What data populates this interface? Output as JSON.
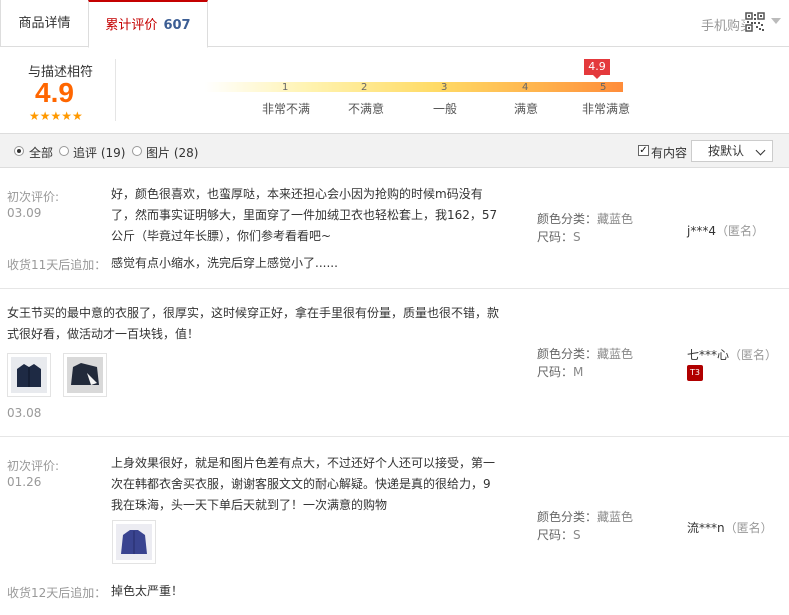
{
  "tabs": {
    "details": "商品详情",
    "reviews": "累计评价",
    "reviews_count": "607",
    "mobile_buy": "手机购买"
  },
  "score": {
    "title": "与描述相符",
    "value": "4.9",
    "stars": "★★★★★",
    "bubble": "4.9",
    "ticks": [
      "1",
      "2",
      "3",
      "4",
      "5"
    ],
    "labels": [
      "非常不满",
      "不满意",
      "一般",
      "满意",
      "非常满意"
    ]
  },
  "filters": {
    "all": "全部",
    "followup": "追评 (19)",
    "photos": "图片 (28)",
    "has_content": "有内容",
    "sort": "按默认"
  },
  "reviews": [
    {
      "initial_label": "初次评价:",
      "date": "03.09",
      "lines": [
        "好，颜色很喜欢，也蛮厚哒，本来还担心会小因为抢购的时候m码没有",
        "了，然而事实证明够大，里面穿了一件加绒卫衣也轻松套上，我162，57",
        "公斤（毕竟过年长膘），你们参考看看吧~"
      ],
      "followup_label": "收货11天后追加：",
      "followup": "感觉有点小缩水，洗完后穿上感觉小了......",
      "color_label": "颜色分类：",
      "color_value": "藏蓝色",
      "size_label": "尺码：",
      "size_value": "S",
      "user": "j***4",
      "anon": "（匿名）"
    },
    {
      "lines": [
        "女王节买的最中意的衣服了，很厚实，这时候穿正好，拿在手里很有份量，质量也很不错，款",
        "式很好看，做活动才一百块钱，值！"
      ],
      "date": "03.08",
      "color_label": "颜色分类：",
      "color_value": "藏蓝色",
      "size_label": "尺码：",
      "size_value": "M",
      "user": "七***心",
      "anon": "（匿名）",
      "badge": "T3"
    },
    {
      "initial_label": "初次评价:",
      "date": "01.26",
      "lines": [
        "上身效果很好，就是和图片色差有点大，不过还好个人还可以接受，第一",
        "次在韩都衣舍买衣服，谢谢客服文文的耐心解疑。快递是真的很给力，9",
        "我在珠海，头一天下单后天就到了！一次满意的购物"
      ],
      "followup_label": "收货12天后追加：",
      "followup": "掉色太严重！",
      "color_label": "颜色分类：",
      "color_value": "藏蓝色",
      "size_label": "尺码：",
      "size_value": "S",
      "user": "流***n",
      "anon": "（匿名）"
    }
  ]
}
